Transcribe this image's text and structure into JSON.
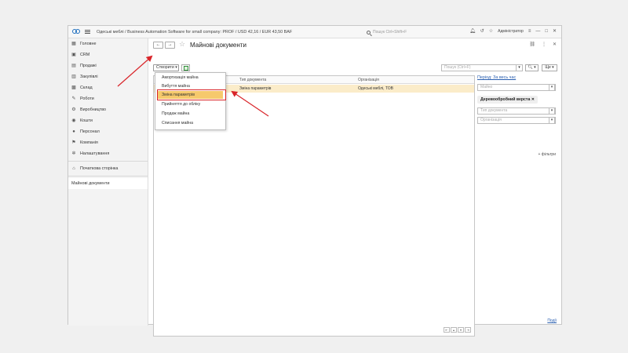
{
  "titlebar": {
    "title": "Одеські меблі / Business Automation Software for small company: PROF / USD 42,16 / EUR 43,50 BAF",
    "search_placeholder": "Пошук Ctrl+Shift+F",
    "user": "Адміністратор"
  },
  "sidebar": {
    "items": [
      {
        "label": "Головне",
        "icon": "grid-icon"
      },
      {
        "label": "CRM",
        "icon": "crm-icon"
      },
      {
        "label": "Продажі",
        "icon": "sales-icon"
      },
      {
        "label": "Закупівлі",
        "icon": "purchases-icon"
      },
      {
        "label": "Склад",
        "icon": "warehouse-icon"
      },
      {
        "label": "Роботи",
        "icon": "wrench-icon"
      },
      {
        "label": "Виробництво",
        "icon": "factory-icon"
      },
      {
        "label": "Кошти",
        "icon": "money-icon"
      },
      {
        "label": "Персонал",
        "icon": "person-icon"
      },
      {
        "label": "Компанія",
        "icon": "flag-icon"
      },
      {
        "label": "Налаштування",
        "icon": "gear-icon"
      }
    ],
    "home_page": "Початкова сторінка",
    "open_doc": "Майнові документи"
  },
  "main": {
    "title": "Майнові документи",
    "create_label": "Створити",
    "search_placeholder": "Пошук (Ctrl+F)",
    "more_label": "Ще"
  },
  "table": {
    "columns": [
      "Тип документа",
      "Організація"
    ],
    "rows": [
      {
        "type": "Зміна параметрів",
        "org": "Одеські меблі, ТОВ"
      }
    ]
  },
  "create_menu": {
    "items": [
      "Амортизація майна",
      "Вибуття майна",
      "Зміна параметрів",
      "Прийняття до обліку",
      "Продаж майна",
      "Списання майна"
    ],
    "highlighted_index": 2
  },
  "filters": {
    "period": "Період: За весь час",
    "property_placeholder": "Майно",
    "chip": "Деревообробний верста",
    "doc_type_placeholder": "Тип документа",
    "org_placeholder": "Організація",
    "add_filter": "+ фільтри"
  },
  "events_link": "Події",
  "colors": {
    "highlight": "#f6c96c",
    "selected_row": "#fbecc9",
    "annotation_red": "#d9252a",
    "link_blue": "#2a5fb0"
  }
}
